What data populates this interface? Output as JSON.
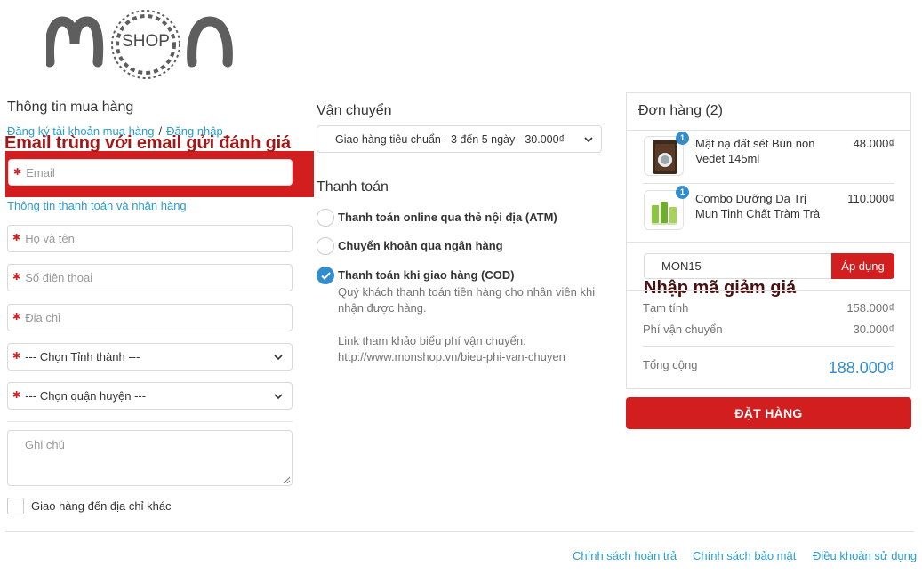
{
  "logo": {
    "text": "SHOP"
  },
  "buyer": {
    "title": "Thông tin mua hàng",
    "register_link": "Đăng ký tài khoản mua hàng",
    "separator": "/",
    "login_link": "Đăng nhập",
    "email_placeholder": "Email",
    "billing_link": "Thông tin thanh toán và nhận hàng",
    "name_placeholder": "Họ và tên",
    "phone_placeholder": "Số điện thoại",
    "address_placeholder": "Địa chỉ",
    "province_selected": "--- Chọn Tỉnh thành ---",
    "district_selected": "--- Chọn quận huyện ---",
    "notes_placeholder": "Ghi chú",
    "alt_address_label": "Giao hàng đến địa chỉ khác"
  },
  "annotations": {
    "email": "Email trùng với email gửi đánh giá",
    "coupon": "Nhập mã giảm giá"
  },
  "shipping": {
    "title": "Vận chuyển",
    "selected": "Giao hàng tiêu chuẩn - 3 đến 5 ngày - 30.000₫"
  },
  "payment": {
    "title": "Thanh toán",
    "options": [
      {
        "label": "Thanh toán online qua thẻ nội địa (ATM)",
        "selected": false
      },
      {
        "label": "Chuyển khoản qua ngân hàng",
        "selected": false
      },
      {
        "label": "Thanh toán khi giao hàng (COD)",
        "selected": true
      }
    ],
    "cod_description": "Quý khách thanh toán tiền hàng cho nhân viên khi nhận được hàng.",
    "reference_text": "Link tham khảo biểu phí vận chuyển: http://www.monshop.vn/bieu-phi-van-chuyen"
  },
  "order": {
    "title": "Đơn hàng (2)",
    "items": [
      {
        "name": "Mặt nạ đất sét Bùn non Vedet 145ml",
        "price": "48.000₫",
        "qty": "1"
      },
      {
        "name": "Combo Dưỡng Da Trị Mụn Tinh Chất Tràm Trà",
        "price": "110.000₫",
        "qty": "1"
      }
    ],
    "coupon_value": "MON15",
    "apply_label": "Áp dụng",
    "subtotal_label": "Tạm tính",
    "subtotal_value": "158.000₫",
    "shipping_label": "Phí vận chuyển",
    "shipping_value": "30.000₫",
    "total_label": "Tổng cộng",
    "total_value": "188.000₫",
    "place_order_label": "ĐẶT HÀNG"
  },
  "footer": {
    "links": [
      "Chính sách hoàn trả",
      "Chính sách bảo mật",
      "Điều khoản sử dụng"
    ]
  },
  "colors": {
    "accent_red": "#d21e1e",
    "link_blue": "#2a9dcc",
    "total_blue": "#338dcc"
  }
}
